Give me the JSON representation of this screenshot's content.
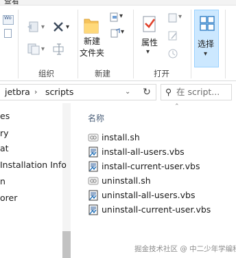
{
  "ribbon": {
    "top_label": "查看",
    "groups": {
      "organize": {
        "label": "组织"
      },
      "new": {
        "label": "新建",
        "new_folder_line1": "新建",
        "new_folder_line2": "文件夹"
      },
      "open": {
        "label": "打开",
        "properties": "属性"
      },
      "select": {
        "label": "选择"
      }
    },
    "left_small": "Wo"
  },
  "address": {
    "crumbs": [
      "jetbra",
      "scripts"
    ],
    "search_placeholder": "在 script..."
  },
  "nav": {
    "items": [
      "es",
      "ry",
      "at",
      "Installation Info",
      "n",
      "orer"
    ]
  },
  "content": {
    "column_header": "名称",
    "files": [
      {
        "name": "install.sh",
        "icon": "sh-file-icon"
      },
      {
        "name": "install-all-users.vbs",
        "icon": "vbs-file-icon"
      },
      {
        "name": "install-current-user.vbs",
        "icon": "vbs-file-icon"
      },
      {
        "name": "uninstall.sh",
        "icon": "sh-file-icon"
      },
      {
        "name": "uninstall-all-users.vbs",
        "icon": "vbs-file-icon"
      },
      {
        "name": "uninstall-current-user.vbs",
        "icon": "vbs-file-icon"
      }
    ]
  },
  "watermark": "掘金技术社区 @ 中二少年学编程"
}
